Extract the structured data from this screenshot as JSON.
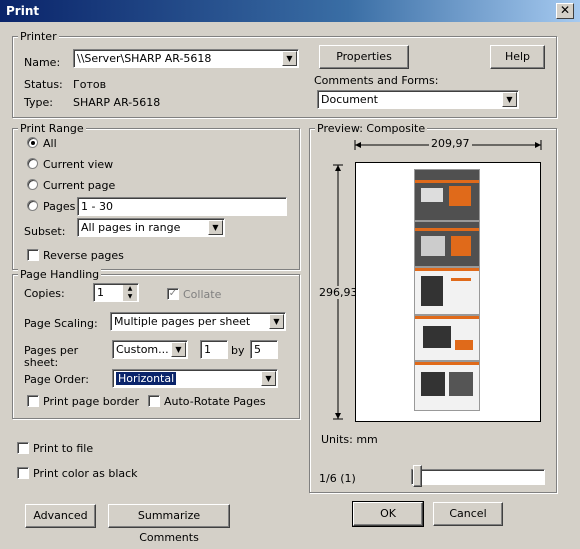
{
  "window": {
    "title": "Print",
    "close_glyph": "✕"
  },
  "printer": {
    "legend": "Printer",
    "name_label": "Name:",
    "name_value": "\\\\Server\\SHARP AR-5618",
    "status_label": "Status:",
    "status_value": "Готов",
    "type_label": "Type:",
    "type_value": "SHARP AR-5618",
    "properties_label": "Properties",
    "help_label": "Help",
    "comments_label": "Comments and Forms:",
    "comments_value": "Document"
  },
  "print_range": {
    "legend": "Print Range",
    "all": "All",
    "current_view": "Current view",
    "current_page": "Current page",
    "pages": "Pages",
    "pages_value": "1 - 30",
    "subset_label": "Subset:",
    "subset_value": "All pages in range",
    "reverse_pages": "Reverse pages"
  },
  "page_handling": {
    "legend": "Page Handling",
    "copies_label": "Copies:",
    "copies_value": "1",
    "collate": "Collate",
    "scaling_label": "Page Scaling:",
    "scaling_value": "Multiple pages per sheet",
    "pps_label_1": "Pages per",
    "pps_label_2": "sheet:",
    "pps_value": "Custom...",
    "cols": "1",
    "by": "by",
    "rows": "5",
    "order_label": "Page Order:",
    "order_value": "Horizontal",
    "print_border": "Print page border",
    "auto_rotate": "Auto-Rotate Pages"
  },
  "options": {
    "print_to_file": "Print to file",
    "print_color_black": "Print color as black"
  },
  "preview": {
    "legend": "Preview: Composite",
    "width_value": "209,97",
    "height_value": "296,93",
    "units": "Units: mm",
    "page_indicator": "1/6 (1)"
  },
  "footer": {
    "advanced": "Advanced",
    "summarize": "Summarize Comments",
    "ok": "OK",
    "cancel": "Cancel"
  },
  "icons": {
    "dropdown": "▼",
    "spin_up": "▲",
    "spin_down": "▼",
    "check": "✓"
  }
}
